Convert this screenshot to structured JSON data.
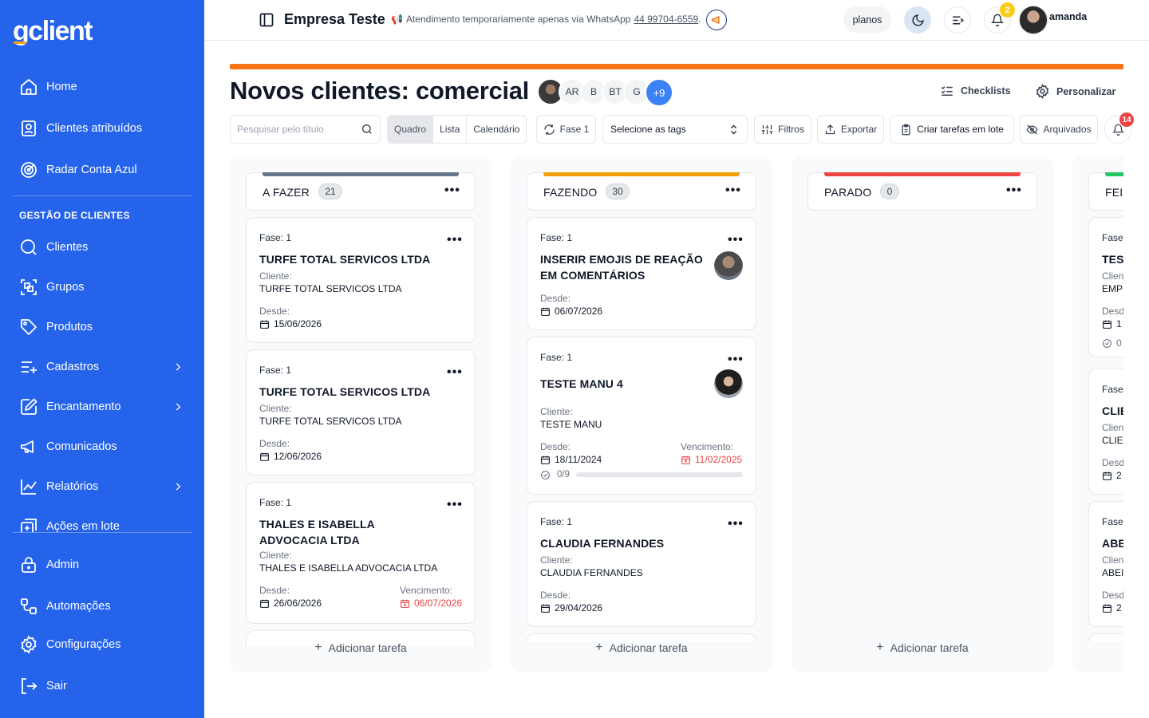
{
  "brand": {
    "logo_g": "g",
    "logo_rest": "client"
  },
  "sidebar": {
    "items": [
      {
        "label": "Home",
        "icon": "home-icon"
      },
      {
        "label": "Clientes atribuídos",
        "icon": "user-badge-icon"
      },
      {
        "label": "Radar Conta Azul",
        "icon": "radar-icon"
      },
      {
        "label": "Clientes",
        "icon": "search-icon"
      },
      {
        "label": "Grupos",
        "icon": "group-icon"
      },
      {
        "label": "Produtos",
        "icon": "tag-icon"
      },
      {
        "label": "Cadastros",
        "icon": "list-plus-icon"
      },
      {
        "label": "Encantamento",
        "icon": "edit-icon"
      },
      {
        "label": "Comunicados",
        "icon": "megaphone-icon"
      },
      {
        "label": "Relatórios",
        "icon": "chart-icon"
      },
      {
        "label": "Ações em lote",
        "icon": "batch-icon"
      },
      {
        "label": "Admin",
        "icon": "lock-icon"
      },
      {
        "label": "Automações",
        "icon": "workflow-icon"
      },
      {
        "label": "Configurações",
        "icon": "gear-icon"
      },
      {
        "label": "Sair",
        "icon": "logout-icon"
      }
    ],
    "section_title": "GESTÃO DE CLIENTES"
  },
  "topbar": {
    "company": "Empresa Teste",
    "notice_text": "Atendimento temporariamente apenas via WhatsApp",
    "notice_phone": "44 99704-6559",
    "notice_end": ".",
    "planos": "planos",
    "notif_count": "2",
    "username": "amanda"
  },
  "board": {
    "title": "Novos clientes: comercial",
    "members": [
      "AR",
      "B",
      "BT",
      "G"
    ],
    "members_more": "+9",
    "checklists": "Checklists",
    "personalizar": "Personalizar"
  },
  "toolbar": {
    "search_placeholder": "Pesquisar pelo título",
    "views": [
      "Quadro",
      "Lista",
      "Calendário"
    ],
    "active_view": "Quadro",
    "fase": "Fase 1",
    "tags_placeholder": "Selecione as tags",
    "filtros": "Filtros",
    "exportar": "Exportar",
    "criar_lote": "Criar tarefas em lote",
    "arquivados": "Arquivados",
    "bell_count": "14"
  },
  "labels": {
    "cliente": "Cliente:",
    "desde": "Desde:",
    "vencimento": "Vencimento:",
    "add_task": "Adicionar tarefa"
  },
  "columns": [
    {
      "name": "A FAZER",
      "count": "21",
      "color": "#64748b",
      "cards": [
        {
          "fase": "Fase: 1",
          "title": "TURFE TOTAL SERVICOS LTDA",
          "cliente": "TURFE TOTAL SERVICOS LTDA",
          "desde": "15/06/2026"
        },
        {
          "fase": "Fase: 1",
          "title": "TURFE TOTAL SERVICOS LTDA",
          "cliente": "TURFE TOTAL SERVICOS LTDA",
          "desde": "12/06/2026"
        },
        {
          "fase": "Fase: 1",
          "title": "THALES E ISABELLA ADVOCACIA LTDA",
          "cliente": "THALES E ISABELLA ADVOCACIA LTDA",
          "desde": "26/06/2026",
          "vencimento": "06/07/2026"
        }
      ]
    },
    {
      "name": "FAZENDO",
      "count": "30",
      "color": "#f59e0b",
      "cards": [
        {
          "fase": "Fase: 1",
          "title": "INSERIR EMOJIS DE REAÇÃO EM COMENTÁRIOS",
          "desde": "06/07/2026"
        },
        {
          "fase": "Fase: 1",
          "title": "TESTE MANU 4",
          "cliente": "TESTE MANU",
          "desde": "18/11/2024",
          "vencimento": "11/02/2025",
          "progress_text": "0/9",
          "progress": 0
        },
        {
          "fase": "Fase: 1",
          "title": "CLAUDIA FERNANDES",
          "cliente": "CLAUDIA FERNANDES",
          "desde": "29/04/2026"
        }
      ]
    },
    {
      "name": "PARADO",
      "count": "0",
      "color": "#ef4444",
      "cards": []
    },
    {
      "name": "FEI",
      "color": "#22c55e",
      "cards": [
        {
          "fase": "Fase",
          "title": "TES",
          "cliente_lbl": "Clien",
          "cliente": "EMP",
          "desde_lbl": "Desd",
          "desde": "1",
          "check": "0"
        },
        {
          "fase": "Fase",
          "title": "CLIE",
          "cliente_lbl": "Clien",
          "cliente": "CLIE",
          "desde_lbl": "Desd",
          "desde": "2"
        },
        {
          "fase": "Fase",
          "title": "ABE",
          "cliente_lbl": "Clien",
          "cliente": "ABEI",
          "desde_lbl": "Desd",
          "desde": "2"
        }
      ]
    }
  ]
}
